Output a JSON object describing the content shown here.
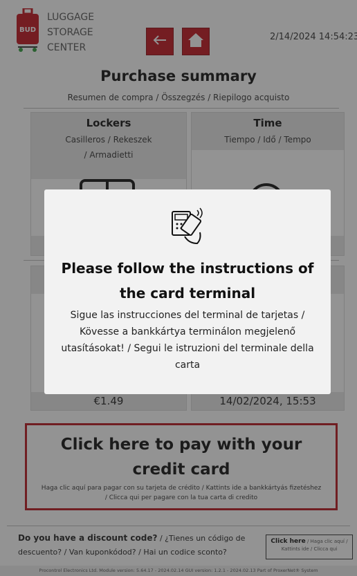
{
  "header": {
    "brand_lines": [
      "LUGGAGE",
      "STORAGE",
      "CENTER"
    ],
    "logo_text": "BUD",
    "datetime": "2/14/2024 14:54:23",
    "colors": {
      "accent": "#c0131c"
    }
  },
  "summary": {
    "title": "Purchase summary",
    "subtitle": "Resumen de compra / Összegzés / Riepilogo acquisto",
    "lockers": {
      "title": "Lockers",
      "sub_line1": "Casilleros  / Rekeszek",
      "sub_line2": "/ Armadietti",
      "icon": "locker-icon"
    },
    "time": {
      "title": "Time",
      "sub_line1": "Tiempo  / Idő  / Tempo",
      "icon": "clock-icon"
    },
    "price": "€1.49",
    "datetime_value": "14/02/2024, 15:53"
  },
  "pay": {
    "title": "Click here to pay with your credit card",
    "subtitle": "Haga clic aquí para pagar con su tarjeta de crédito  / Kattints ide a bankkártyás fizetéshez  / Clicca qui per pagare con la tua carta di credito"
  },
  "discount": {
    "question": "Do you have a discount code?",
    "translations": " / ¿Tienes un código de descuento?  / Van kuponkódod?  / Hai un codice sconto?",
    "button_main": "Click here",
    "button_sub": " / Haga clic aquí / Kattints ide  / Clicca qui"
  },
  "footer": {
    "text": "Procontrol Electronics Ltd.  Module version: 5.64.17 - 2024.02.14 GUI version: 1.2.1 - 2024.02.13  Part of ProxerNet® System"
  },
  "modal": {
    "icon": "card-terminal-icon",
    "title": "Please follow the instructions of the card terminal",
    "text": "Sigue las instrucciones del terminal de tarjetas  / Kövesse a bankkártya terminálon megjelenő utasításokat!  / Segui le istruzioni del terminale della carta"
  }
}
